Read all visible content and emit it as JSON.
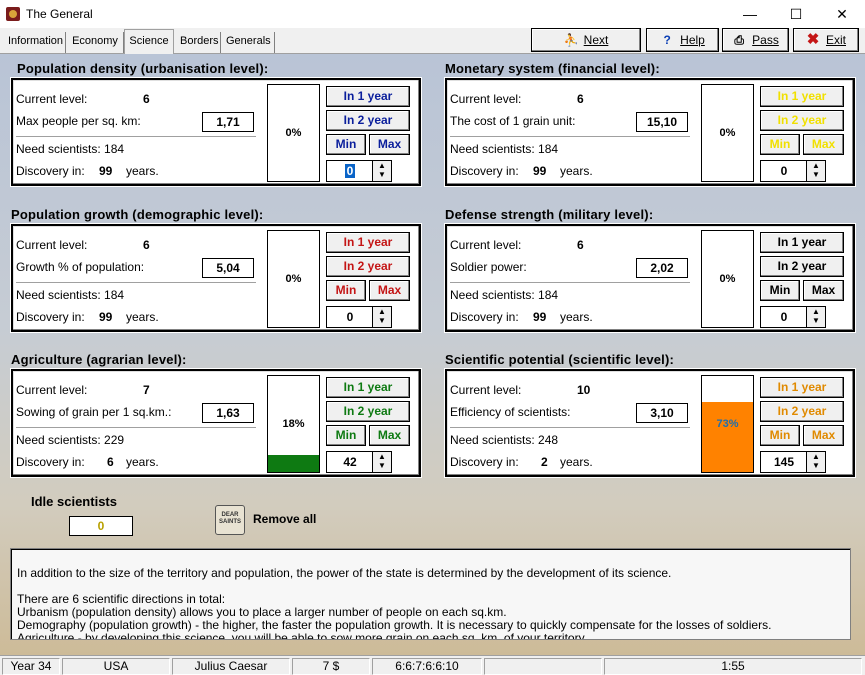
{
  "window": {
    "title": "The General",
    "minimize": "—",
    "maximize": "☐",
    "close": "✕"
  },
  "tabs": [
    "Information",
    "Economy",
    "Science",
    "Borders",
    "Generals"
  ],
  "toolbar": {
    "next": "Next",
    "help": "Help",
    "pass": "Pass",
    "exit": "Exit"
  },
  "common": {
    "current_level": "Current level:",
    "in1": "In 1 year",
    "in2": "In 2 year",
    "min": "Min",
    "max": "Max",
    "discovery": "Discovery in:",
    "years": "years."
  },
  "panels": [
    {
      "title": "Population density (urbanisation level):",
      "level": "6",
      "param_label": "Max people per sq. km:",
      "param_value": "1,71",
      "need": "Need scientists: 184",
      "discovery_years": "99",
      "percent": "0%",
      "fill": 0,
      "spin_value": "0",
      "spin_selected": true,
      "btn_color": "#0b1f9c"
    },
    {
      "title": "Monetary system (financial level):",
      "level": "6",
      "param_label": "The cost of 1 grain unit:",
      "param_value": "15,10",
      "need": "Need scientists: 184",
      "discovery_years": "99",
      "percent": "0%",
      "fill": 0,
      "spin_value": "0",
      "spin_selected": false,
      "btn_color": "#f1e000"
    },
    {
      "title": "Population growth (demographic level):",
      "level": "6",
      "param_label": "Growth % of population:",
      "param_value": "5,04",
      "need": "Need scientists: 184",
      "discovery_years": "99",
      "percent": "0%",
      "fill": 0,
      "spin_value": "0",
      "spin_selected": false,
      "btn_color": "#c41515"
    },
    {
      "title": "Defense strength (military level):",
      "level": "6",
      "param_label": "Soldier power:",
      "param_value": "2,02",
      "need": "Need scientists: 184",
      "discovery_years": "99",
      "percent": "0%",
      "fill": 0,
      "spin_value": "0",
      "spin_selected": false,
      "btn_color": "#000000"
    },
    {
      "title": "Agriculture (agrarian level):",
      "level": "7",
      "param_label": "Sowing of grain per 1 sq.km.:",
      "param_value": "1,63",
      "need": "Need scientists: 229",
      "discovery_years": "6",
      "percent": "18%",
      "fill": 0.18,
      "fill_color": "#0e7a12",
      "spin_value": "42",
      "spin_selected": false,
      "btn_color": "#0e7a12"
    },
    {
      "title": "Scientific potential (scientific level):",
      "level": "10",
      "param_label": "Efficiency of scientists:",
      "param_value": "3,10",
      "need": "Need scientists: 248",
      "discovery_years": "2",
      "percent": "73%",
      "fill": 0.73,
      "fill_color": "#ff8200",
      "pct_color": "#1f6fae",
      "spin_value": "145",
      "spin_selected": false,
      "btn_color": "#e08a00"
    }
  ],
  "idle": {
    "label": "Idle scientists",
    "value": "0",
    "remove_all": "Remove all",
    "scroll_icon_text": "DEAR SAINTS"
  },
  "info_lines": [
    "In addition to the size of the territory and population, the power of the state is determined by the development of its science.",
    "",
    "There are 6 scientific directions in total:",
    "Urbanism (population density) allows you to place a larger number of people on each sq.km.",
    "Demography (population growth) - the higher, the faster the population growth. It is necessary to quickly compensate for the losses of soldiers.",
    "Agriculture - by developing this science, you will be able to sow more grain on each sq. km. of your territory."
  ],
  "status": {
    "year": "Year 34",
    "country": "USA",
    "ruler": "Julius Caesar",
    "money": "7 $",
    "ratio": "6:6:7:6:6:10",
    "extra": "",
    "time": "1:55"
  },
  "icons": {
    "app": "app-icon",
    "next": "running-man-icon",
    "help": "question-icon",
    "pass": "printer-icon",
    "exit": "red-x-icon"
  }
}
